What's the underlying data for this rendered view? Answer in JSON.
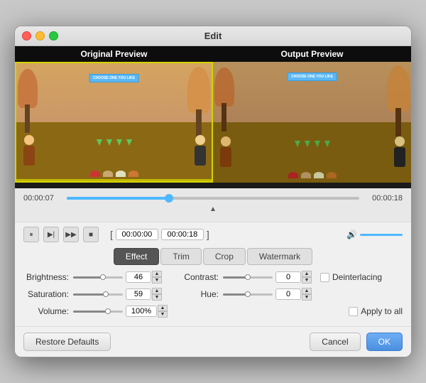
{
  "window": {
    "title": "Edit"
  },
  "preview": {
    "original_label": "Original Preview",
    "output_label": "Output Preview"
  },
  "timeline": {
    "start_time": "00:00:07",
    "end_time": "00:00:18",
    "fill_percent": 35,
    "thumb_percent": 35,
    "clip_start": "00:00:00",
    "clip_end": "00:00:18"
  },
  "playback": {
    "pause_icon": "⏸",
    "next_icon": "⏭",
    "step_icon": "⏩",
    "stop_icon": "⏹"
  },
  "tabs": [
    {
      "id": "effect",
      "label": "Effect",
      "active": true
    },
    {
      "id": "trim",
      "label": "Trim",
      "active": false
    },
    {
      "id": "crop",
      "label": "Crop",
      "active": false
    },
    {
      "id": "watermark",
      "label": "Watermark",
      "active": false
    }
  ],
  "settings": {
    "brightness": {
      "label": "Brightness:",
      "value": "46",
      "fill_percent": 60
    },
    "contrast": {
      "label": "Contrast:",
      "value": "0",
      "fill_percent": 50
    },
    "saturation": {
      "label": "Saturation:",
      "value": "59",
      "fill_percent": 65
    },
    "hue": {
      "label": "Hue:",
      "value": "0",
      "fill_percent": 50
    },
    "volume": {
      "label": "Volume:",
      "value": "100%",
      "fill_percent": 70
    },
    "deinterlacing_label": "Deinterlacing",
    "apply_to_all_label": "Apply to all"
  },
  "buttons": {
    "restore": "Restore Defaults",
    "cancel": "Cancel",
    "ok": "OK"
  },
  "banner_text": "CHOOSE ONE YOU LIKE"
}
